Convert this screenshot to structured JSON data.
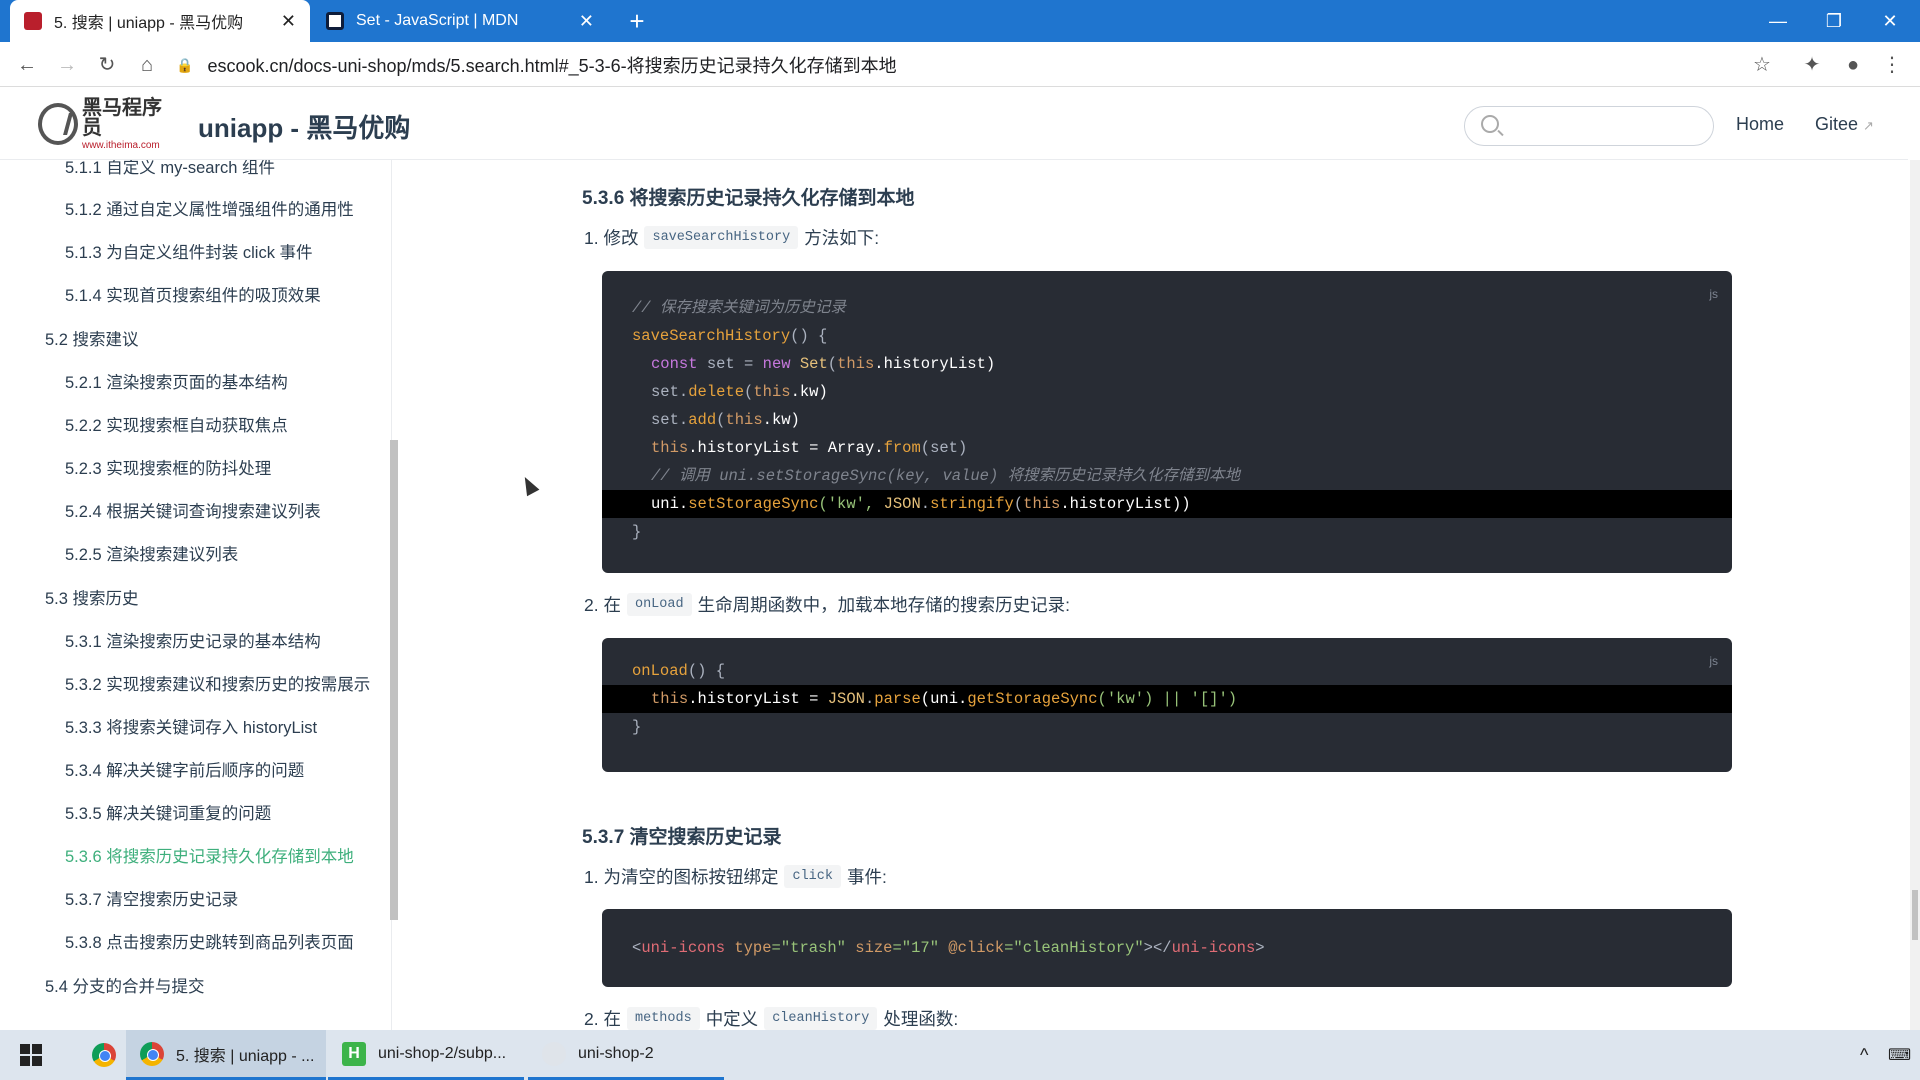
{
  "browser": {
    "tabs": [
      {
        "title": "5. 搜索 | uniapp - 黑马优购",
        "active": true
      },
      {
        "title": "Set - JavaScript | MDN",
        "active": false
      }
    ],
    "new_tab": "+",
    "url": "escook.cn/docs-uni-shop/mds/5.search.html#_5-3-6-将搜索历史记录持久化存储到本地",
    "icons": {
      "back": "←",
      "forward": "→",
      "reload": "↻",
      "home": "⌂",
      "star": "☆",
      "extensions": "✦",
      "profile": "●",
      "menu": "⋮",
      "minimize": "—",
      "restore": "❐",
      "close": "✕"
    }
  },
  "site": {
    "logo_cn": "黑马程序员",
    "logo_url": "www.itheima.com",
    "title": "uniapp - 黑马优购",
    "nav": [
      {
        "label": "Home"
      },
      {
        "label": "Gitee"
      }
    ],
    "gitee_external_icon": "↗"
  },
  "sidebar": {
    "items": [
      {
        "label": "5.1.1 自定义 my-search 组件",
        "level": "sub"
      },
      {
        "label": "5.1.2 通过自定义属性增强组件的通用性",
        "level": "sub"
      },
      {
        "label": "5.1.3 为自定义组件封装 click 事件",
        "level": "sub"
      },
      {
        "label": "5.1.4 实现首页搜索组件的吸顶效果",
        "level": "sub"
      },
      {
        "label": "5.2 搜索建议",
        "level": "group"
      },
      {
        "label": "5.2.1 渲染搜索页面的基本结构",
        "level": "sub"
      },
      {
        "label": "5.2.2 实现搜索框自动获取焦点",
        "level": "sub"
      },
      {
        "label": "5.2.3 实现搜索框的防抖处理",
        "level": "sub"
      },
      {
        "label": "5.2.4 根据关键词查询搜索建议列表",
        "level": "sub"
      },
      {
        "label": "5.2.5 渲染搜索建议列表",
        "level": "sub"
      },
      {
        "label": "5.3 搜索历史",
        "level": "group"
      },
      {
        "label": "5.3.1 渲染搜索历史记录的基本结构",
        "level": "sub"
      },
      {
        "label": "5.3.2 实现搜索建议和搜索历史的按需展示",
        "level": "sub"
      },
      {
        "label": "5.3.3 将搜索关键词存入 historyList",
        "level": "sub"
      },
      {
        "label": "5.3.4 解决关键字前后顺序的问题",
        "level": "sub"
      },
      {
        "label": "5.3.5 解决关键词重复的问题",
        "level": "sub"
      },
      {
        "label": "5.3.6 将搜索历史记录持久化存储到本地",
        "level": "sub",
        "active": true
      },
      {
        "label": "5.3.7 清空搜索历史记录",
        "level": "sub"
      },
      {
        "label": "5.3.8 点击搜索历史跳转到商品列表页面",
        "level": "sub"
      },
      {
        "label": "5.4 分支的合并与提交",
        "level": "group"
      }
    ]
  },
  "content": {
    "sec_536": "5.3.6 将搜索历史记录持久化存储到本地",
    "p1_prefix": "1. 修改",
    "p1_code": "saveSearchHistory",
    "p1_suffix": "方法如下:",
    "code1_lang": "js",
    "code1": {
      "l1": "// 保存搜索关键词为历史记录",
      "l2_fn": "saveSearchHistory",
      "l2_rest": "() {",
      "l3_a": "const",
      "l3_b": " set = ",
      "l3_c": "new",
      "l3_d": " Set",
      "l3_e": "(",
      "l3_f": "this",
      "l3_g": ".historyList)",
      "l4_a": "set.",
      "l4_b": "delete",
      "l4_c": "(",
      "l4_d": "this",
      "l4_e": ".kw)",
      "l5_a": "set.",
      "l5_b": "add",
      "l5_c": "(",
      "l5_d": "this",
      "l5_e": ".kw)",
      "l6_a": "this",
      "l6_b": ".historyList = Array.",
      "l6_c": "from",
      "l6_d": "(set)",
      "l7": "// 调用 uni.setStorageSync(key, value) 将搜索历史记录持久化存储到本地",
      "l8_a": "uni.",
      "l8_b": "setStorageSync",
      "l8_c": "('kw', ",
      "l8_d": "JSON",
      "l8_e": ".",
      "l8_f": "stringify",
      "l8_g": "(",
      "l8_h": "this",
      "l8_i": ".historyList))",
      "l9": "}"
    },
    "p2_prefix": "2. 在",
    "p2_code": "onLoad",
    "p2_suffix": "生命周期函数中，加载本地存储的搜索历史记录:",
    "code2_lang": "js",
    "code2": {
      "l1_fn": "onLoad",
      "l1_rest": "() {",
      "l2_a": "this",
      "l2_b": ".historyList = ",
      "l2_c": "JSON",
      "l2_d": ".",
      "l2_e": "parse",
      "l2_f": "(uni.",
      "l2_g": "getStorageSync",
      "l2_h": "('kw') || '[]')",
      "l3": "}"
    },
    "sec_537": "5.3.7 清空搜索历史记录",
    "p3_prefix": "1. 为清空的图标按钮绑定",
    "p3_code": "click",
    "p3_suffix": "事件:",
    "code3": {
      "a": "<",
      "b": "uni-icons",
      "c": " type",
      "d": "=\"trash\"",
      "e": " size",
      "f": "=\"17\"",
      "g": " @click",
      "h": "=\"cleanHistory\"",
      "i": "></",
      "j": "uni-icons",
      "k": ">"
    },
    "p4_prefix": "2. 在",
    "p4_code1": "methods",
    "p4_mid": "中定义",
    "p4_code2": "cleanHistory",
    "p4_suffix": "处理函数:"
  },
  "taskbar": {
    "items": [
      {
        "label": "5. 搜索 | uniapp - ..."
      },
      {
        "label": "uni-shop-2/subp..."
      },
      {
        "label": "uni-shop-2"
      }
    ],
    "hbuilder_letter": "H",
    "tray_up": "^",
    "tray_icon": "⌨"
  },
  "colors": {
    "accent": "#3eaf7c",
    "tabbar": "#1f75cf",
    "code_bg": "#282c34",
    "code_hl": "#000000"
  }
}
